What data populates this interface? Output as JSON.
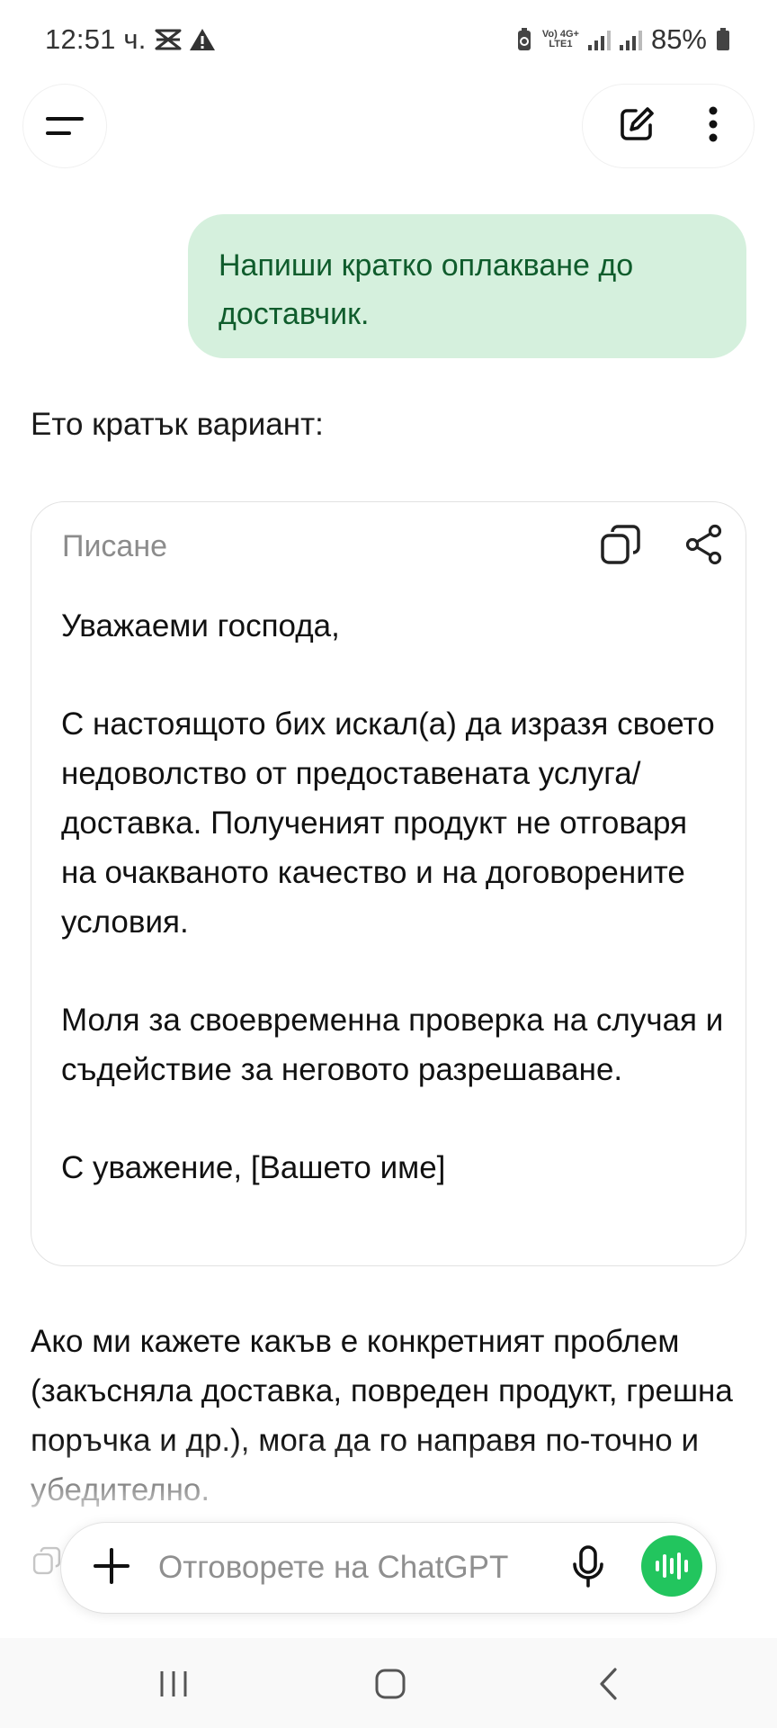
{
  "status_bar": {
    "time": "12:51 ч.",
    "battery_percent": "85%",
    "network_label_top": "Vo) 4G+",
    "network_label_bottom": "LTE1"
  },
  "conversation": {
    "user_message": "Напиши кратко оплакване до доставчик.",
    "assistant_intro": "Ето кратък вариант:",
    "card": {
      "title": "Писане",
      "paragraphs": [
        "Уважаеми господа,",
        "С настоящото бих искал(а) да изразя своето недоволство от предоставената услуга/доставка. Полученият продукт не отговаря на очакваното качество и на договорените условия.",
        "Моля за своевременна проверка на случая и съдействие за неговото разрешаване.",
        "С уважение, [Вашето име]"
      ]
    },
    "assistant_outro": "Ако ми кажете какъв е конкретният проблем (закъсняла доставка, повреден продукт, грешна поръчка и др.), мога да го направя по-точно и убедително."
  },
  "composer": {
    "placeholder": "Отговорете на ChatGPT"
  },
  "colors": {
    "user_bubble_bg": "#d5f0dd",
    "user_bubble_text": "#0f5c2c",
    "voice_button": "#22c55e"
  },
  "icons": [
    "menu-icon",
    "new-chat-icon",
    "more-vertical-icon",
    "copy-icon",
    "share-icon",
    "plus-icon",
    "mic-icon",
    "voice-wave-icon",
    "recent-apps-icon",
    "home-icon",
    "back-icon"
  ]
}
